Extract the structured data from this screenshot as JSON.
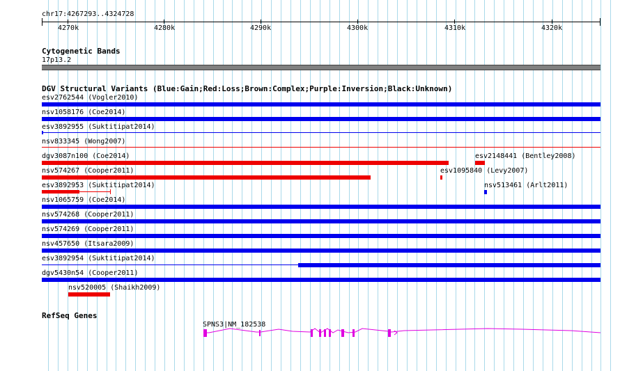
{
  "ruler": {
    "location": "chr17:4267293..4324728",
    "ticks": [
      "4270k",
      "4280k",
      "4290k",
      "4300k",
      "4310k",
      "4320k"
    ]
  },
  "cytoband": {
    "title": "Cytogenetic Bands",
    "band": "17p13.2"
  },
  "dgv": {
    "title": "DGV Structural Variants (Blue:Gain;Red:Loss;Brown:Complex;Purple:Inversion;Black:Unknown)",
    "variants": [
      "esv2762544 (Vogler2010)",
      "nsv1058176 (Coe2014)",
      "esv3892955 (Suktitipat2014)",
      "nsv833345 (Wong2007)",
      "dgv3087n100 (Coe2014)",
      "esv2148441 (Bentley2008)",
      "nsv574267 (Cooper2011)",
      "esv1095840 (Levy2007)",
      "esv3892953 (Suktitipat2014)",
      "nsv513461 (Arlt2011)",
      "nsv1065759 (Coe2014)",
      "nsv574268 (Cooper2011)",
      "nsv574269 (Cooper2011)",
      "nsv457650 (Itsara2009)",
      "esv3892954 (Suktitipat2014)",
      "dgv5430n54 (Cooper2011)",
      "nsv520005 (Shaikh2009)"
    ]
  },
  "refseq": {
    "title": "RefSeq Genes",
    "gene": "SPNS3|NM_182538"
  },
  "colors": {
    "gain": "#0000ee",
    "loss": "#ee0000",
    "gene": "#e000e0",
    "grid": "#a9d9ea",
    "band": "#808080"
  }
}
